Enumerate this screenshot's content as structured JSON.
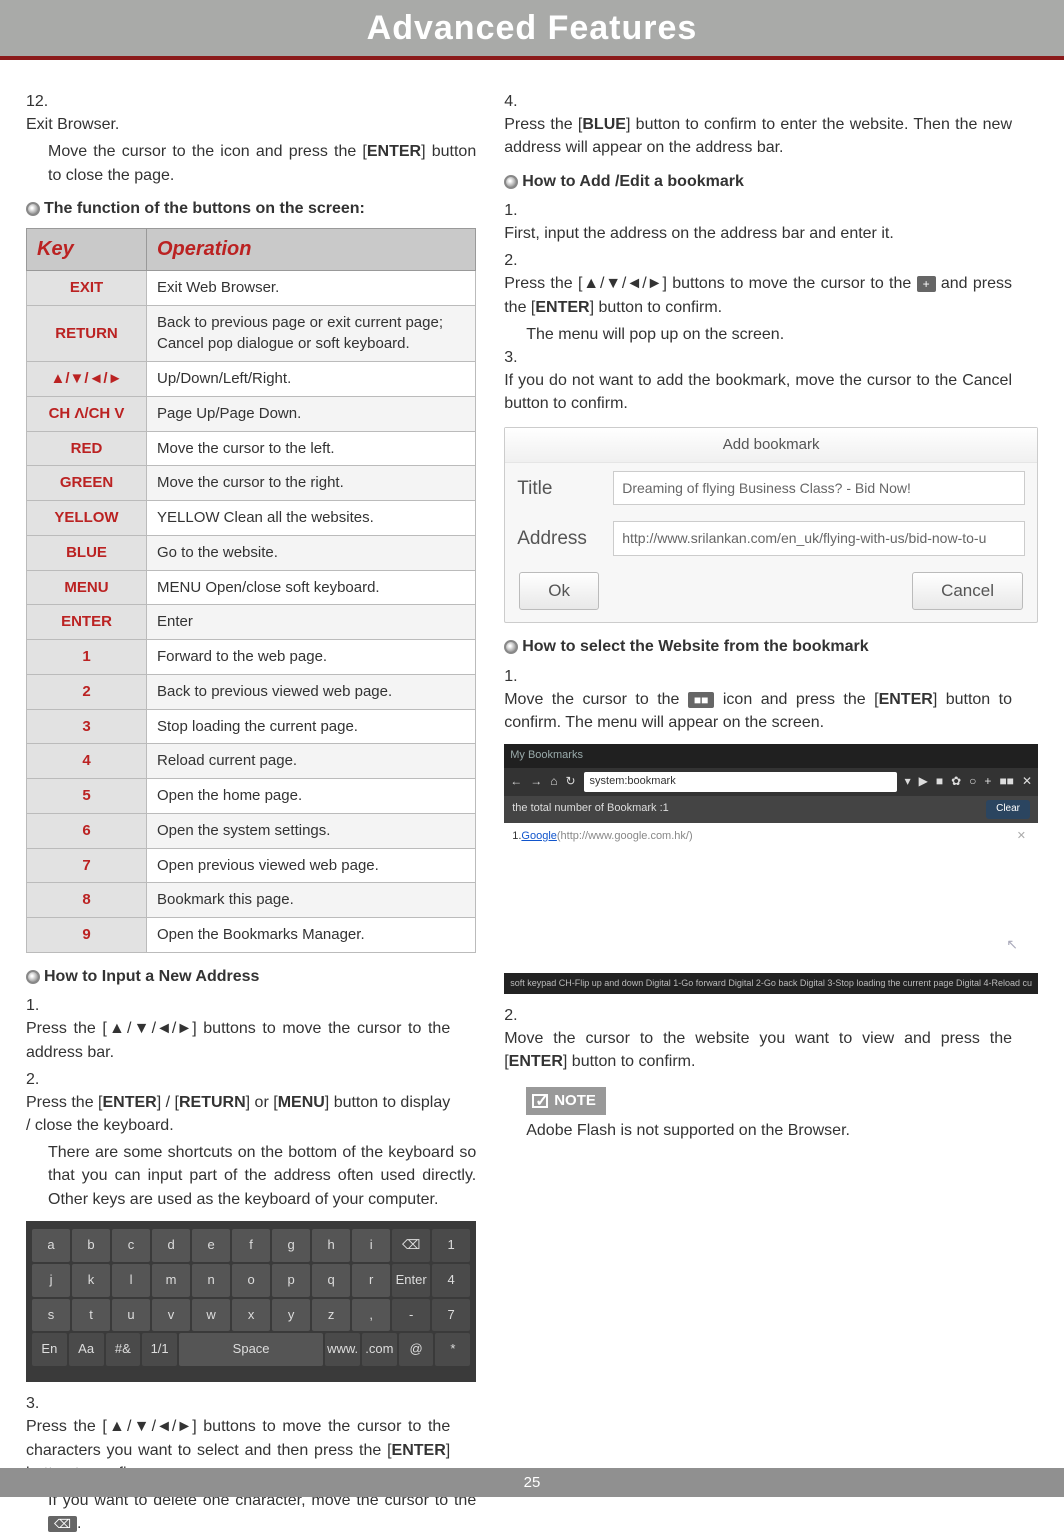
{
  "header": {
    "title": "Advanced Features"
  },
  "footer": {
    "page": "25"
  },
  "left": {
    "step12": {
      "num": "12.",
      "title": "Exit Browser.",
      "body_a": "Move the cursor to the icon and press the [",
      "body_b": "ENTER",
      "body_c": "] button to close the page."
    },
    "tableHeading": "The function of the buttons on the screen:",
    "table": {
      "head_key": "Key",
      "head_op": "Operation",
      "rows": [
        {
          "k": "EXIT",
          "op": "Exit Web Browser."
        },
        {
          "k": "RETURN",
          "op": "Back to previous page or exit current page; Cancel pop dialogue or soft keyboard."
        },
        {
          "k": "▲/▼/◄/►",
          "op": "Up/Down/Left/Right."
        },
        {
          "k": "CH Λ/CH V",
          "op": "Page Up/Page Down."
        },
        {
          "k": "RED",
          "op": "Move the cursor to the left."
        },
        {
          "k": "GREEN",
          "op": "Move the cursor to the right."
        },
        {
          "k": "YELLOW",
          "op": "YELLOW Clean all the websites."
        },
        {
          "k": "BLUE",
          "op": "Go to the website."
        },
        {
          "k": "MENU",
          "op": "MENU Open/close soft keyboard."
        },
        {
          "k": "ENTER",
          "op": "Enter"
        },
        {
          "k": "1",
          "op": "Forward to the web page."
        },
        {
          "k": "2",
          "op": "Back to previous viewed web page."
        },
        {
          "k": "3",
          "op": "Stop loading the current page."
        },
        {
          "k": "4",
          "op": "Reload current page."
        },
        {
          "k": "5",
          "op": "Open the home page."
        },
        {
          "k": "6",
          "op": "Open the system settings."
        },
        {
          "k": "7",
          "op": "Open previous viewed web page."
        },
        {
          "k": "8",
          "op": "Bookmark this page."
        },
        {
          "k": "9",
          "op": "Open the Bookmarks Manager."
        }
      ]
    },
    "howInput": "How to Input a New Address",
    "s1": {
      "n": "1.",
      "a": "Press the [▲/▼/◄/►] buttons to move the cursor to the address bar."
    },
    "s2": {
      "n": "2.",
      "a": "Press the [",
      "b": "ENTER",
      "c": "] / [",
      "d": "RETURN",
      "e": "] or [",
      "f": "MENU",
      "g": "] button to display / close the keyboard."
    },
    "s2note": "There are some shortcuts on the bottom of the keyboard so that you can input part of the address often used directly. Other keys are used as the keyboard of your computer.",
    "keyboard": {
      "r1": [
        "a",
        "b",
        "c",
        "d",
        "e",
        "f",
        "g",
        "h",
        "i",
        "⌫",
        "1"
      ],
      "r2": [
        "j",
        "k",
        "l",
        "m",
        "n",
        "o",
        "p",
        "q",
        "r",
        "Enter",
        "4"
      ],
      "r3": [
        "s",
        "t",
        "u",
        "v",
        "w",
        "x",
        "y",
        "z",
        ",",
        "-",
        "7"
      ],
      "r4": [
        "En",
        "Aa",
        "#&",
        "1/1",
        "Space",
        "www.",
        ".com",
        "@",
        "*"
      ]
    },
    "s3": {
      "n": "3.",
      "a": "Press the [▲/▼/◄/►] buttons to move the cursor to the characters you want to select and then press the [",
      "b": "ENTER",
      "c": "] button to confirm."
    },
    "s3b": {
      "a": "If you want to delete one character, move the cursor to the ",
      "icon": "⌫",
      "b": "."
    }
  },
  "right": {
    "s4": {
      "n": "4.",
      "a": "Press the [",
      "b": "BLUE",
      "c": "] button to confirm to enter the website. Then the new address will appear on the address bar."
    },
    "howAdd": "How to Add /Edit a bookmark",
    "a1": {
      "n": "1.",
      "a": "First, input the address on the address bar and enter it."
    },
    "a2": {
      "n": "2.",
      "a": "Press the [▲/▼/◄/►] buttons to move the cursor to the ",
      "icon": "+",
      "b": " and press the [",
      "c": "ENTER",
      "d": "] button to confirm."
    },
    "a2b": "The menu will pop up on the screen.",
    "a3": {
      "n": "3.",
      "a": "If you do not want to add the bookmark, move the cursor to the Cancel button to confirm."
    },
    "addBookmark": {
      "title": "Add bookmark",
      "labelTitle": "Title",
      "valTitle": "Dreaming of flying Business Class? - Bid Now!",
      "labelAddr": "Address",
      "valAddr": "http://www.srilankan.com/en_uk/flying-with-us/bid-now-to-u",
      "ok": "Ok",
      "cancel": "Cancel"
    },
    "howSelect": "How to select the Website from the bookmark",
    "b1": {
      "n": "1.",
      "a": "Move the cursor to the ",
      "icon": "■■",
      "b": " icon and press the [",
      "c": "ENTER",
      "d": "] button to confirm. The menu will appear on the screen."
    },
    "bookmarks": {
      "head": "My Bookmarks",
      "url": "system:bookmark",
      "count": "the total number of Bookmark :1",
      "clear": "Clear",
      "item_n": "1.",
      "item_link": "Google",
      "item_url": "(http://www.google.com.hk/)",
      "footer": "soft keypad    CH-Flip up and down    Digital 1-Go forward    Digital 2-Go back    Digital 3-Stop loading the current page    Digital 4-Reload cu"
    },
    "b2": {
      "n": "2.",
      "a": "Move the cursor to the website you want to view and press the [",
      "b": "ENTER",
      "c": "] button to confirm."
    },
    "noteLabel": "NOTE",
    "noteBody": "Adobe Flash is not supported on the Browser."
  }
}
